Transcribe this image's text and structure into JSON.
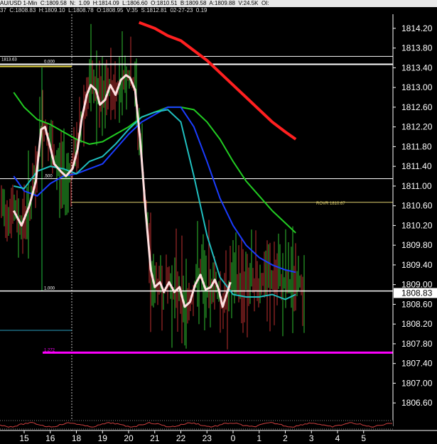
{
  "header": {
    "line1": "AU/USD 1-Min  C:1809.58  N:  1.09  H:1814.09  L:1806.60  O:1810.51  B:1809.58  A:1809.88  V:24.5K  OI:",
    "line2": "37  C:1808.83  H:1809.10  L:1808.78  O:1808.95  V:35  S:1812.81  02-27-23  0.19"
  },
  "chart_data": {
    "type": "line",
    "ylim": [
      1806.3,
      1814.4
    ],
    "y_ticks": [
      "1814.20",
      "1813.80",
      "1813.40",
      "1813.00",
      "1812.60",
      "1812.20",
      "1811.80",
      "1811.40",
      "1811.00",
      "1810.60",
      "1810.20",
      "1809.80",
      "1809.40",
      "1809.00",
      "1808.60",
      "1808.20",
      "1807.80",
      "1807.40",
      "1807.00",
      "1806.60"
    ],
    "x_ticks": [
      "15",
      "16",
      "18",
      "19",
      "20",
      "21",
      "22",
      "23",
      "0",
      "1",
      "2",
      "3",
      "4",
      "5"
    ],
    "current_price": "1808.83",
    "levels": [
      {
        "name": "top-level",
        "value": 1813.63,
        "label": "1813.63",
        "color": "#ffffff"
      },
      {
        "name": "level-000",
        "value": 1813.47,
        "label": "0.000",
        "color": "#ffffff"
      },
      {
        "name": "level-500",
        "value": 1811.15,
        "label": ".500",
        "color": "#ffffff"
      },
      {
        "name": "rovr",
        "value": 1810.67,
        "label": "ROVR 1810.67",
        "color": "#e0d070"
      },
      {
        "name": "level-1000",
        "value": 1808.87,
        "label": "1.000",
        "color": "#ffffff"
      },
      {
        "name": "level-1272",
        "value": 1807.62,
        "label": "1.272",
        "color": "#ff00ff"
      }
    ],
    "series": [
      {
        "color": "#ff2020",
        "points": [
          [
            19.4,
            1814.32
          ],
          [
            20.0,
            1814.2
          ],
          [
            20.5,
            1814.05
          ],
          [
            21.0,
            1813.95
          ],
          [
            21.5,
            1813.75
          ],
          [
            22.0,
            1813.55
          ],
          [
            22.5,
            1813.3
          ],
          [
            23.0,
            1813.05
          ],
          [
            23.5,
            1812.8
          ],
          [
            24.0,
            1812.55
          ],
          [
            24.5,
            1812.3
          ],
          [
            25.0,
            1812.1
          ],
          [
            25.4,
            1811.95
          ]
        ]
      },
      {
        "color": "#22cc22",
        "points": [
          [
            14.6,
            1812.9
          ],
          [
            15.0,
            1812.6
          ],
          [
            15.5,
            1812.35
          ],
          [
            16.0,
            1812.25
          ],
          [
            16.5,
            1812.1
          ],
          [
            17.0,
            1811.95
          ],
          [
            17.5,
            1811.85
          ],
          [
            18.0,
            1811.9
          ],
          [
            18.5,
            1812.05
          ],
          [
            19.0,
            1812.2
          ],
          [
            19.5,
            1812.4
          ],
          [
            20.0,
            1812.5
          ],
          [
            20.5,
            1812.6
          ],
          [
            21.0,
            1812.6
          ],
          [
            21.5,
            1812.55
          ],
          [
            22.0,
            1812.3
          ],
          [
            22.5,
            1811.95
          ],
          [
            23.0,
            1811.5
          ],
          [
            23.5,
            1811.1
          ],
          [
            24.0,
            1810.8
          ],
          [
            24.5,
            1810.5
          ],
          [
            25.0,
            1810.25
          ],
          [
            25.4,
            1810.05
          ]
        ]
      },
      {
        "color": "#1a3cff",
        "points": [
          [
            14.6,
            1811.2
          ],
          [
            15.0,
            1810.9
          ],
          [
            15.5,
            1810.8
          ],
          [
            16.0,
            1811.05
          ],
          [
            16.5,
            1811.2
          ],
          [
            17.0,
            1811.25
          ],
          [
            17.5,
            1811.35
          ],
          [
            18.0,
            1811.45
          ],
          [
            18.5,
            1811.75
          ],
          [
            19.0,
            1812.05
          ],
          [
            19.5,
            1812.3
          ],
          [
            20.0,
            1812.45
          ],
          [
            20.5,
            1812.6
          ],
          [
            21.0,
            1812.6
          ],
          [
            21.5,
            1812.2
          ],
          [
            22.0,
            1811.5
          ],
          [
            22.5,
            1810.75
          ],
          [
            23.0,
            1810.2
          ],
          [
            23.5,
            1809.8
          ],
          [
            24.0,
            1809.55
          ],
          [
            24.5,
            1809.4
          ],
          [
            25.0,
            1809.3
          ],
          [
            25.4,
            1809.25
          ]
        ]
      },
      {
        "color": "#20c0c0",
        "points": [
          [
            14.6,
            1811.0
          ],
          [
            15.0,
            1810.95
          ],
          [
            15.5,
            1811.3
          ],
          [
            16.0,
            1811.4
          ],
          [
            16.5,
            1811.35
          ],
          [
            17.0,
            1811.25
          ],
          [
            17.5,
            1811.5
          ],
          [
            18.0,
            1811.6
          ],
          [
            18.5,
            1811.85
          ],
          [
            19.0,
            1812.15
          ],
          [
            19.5,
            1812.4
          ],
          [
            20.0,
            1812.5
          ],
          [
            20.5,
            1812.55
          ],
          [
            21.0,
            1812.3
          ],
          [
            21.5,
            1811.2
          ],
          [
            22.0,
            1810.0
          ],
          [
            22.5,
            1809.15
          ],
          [
            23.0,
            1808.8
          ],
          [
            23.5,
            1808.75
          ],
          [
            24.0,
            1808.75
          ],
          [
            24.5,
            1808.8
          ],
          [
            25.0,
            1808.7
          ],
          [
            25.4,
            1808.8
          ]
        ]
      },
      {
        "color": "#ffe0e0",
        "points": [
          [
            14.6,
            1810.5
          ],
          [
            14.9,
            1810.2
          ],
          [
            15.2,
            1810.6
          ],
          [
            15.45,
            1811.1
          ],
          [
            15.65,
            1812.15
          ],
          [
            15.8,
            1812.2
          ],
          [
            15.95,
            1811.9
          ],
          [
            16.15,
            1811.45
          ],
          [
            16.4,
            1811.3
          ],
          [
            16.6,
            1811.2
          ],
          [
            16.85,
            1811.35
          ],
          [
            17.05,
            1811.75
          ],
          [
            17.2,
            1812.35
          ],
          [
            17.4,
            1812.85
          ],
          [
            17.55,
            1813.05
          ],
          [
            17.75,
            1812.95
          ],
          [
            17.9,
            1812.65
          ],
          [
            18.1,
            1812.75
          ],
          [
            18.3,
            1813.05
          ],
          [
            18.5,
            1812.85
          ],
          [
            18.7,
            1813.15
          ],
          [
            18.9,
            1813.25
          ],
          [
            19.05,
            1813.2
          ],
          [
            19.25,
            1812.95
          ],
          [
            19.45,
            1811.9
          ],
          [
            19.65,
            1810.5
          ],
          [
            19.85,
            1809.3
          ],
          [
            20.0,
            1808.95
          ],
          [
            20.2,
            1809.05
          ],
          [
            20.35,
            1808.85
          ],
          [
            20.55,
            1809.05
          ],
          [
            20.75,
            1808.85
          ],
          [
            20.95,
            1808.95
          ],
          [
            21.15,
            1808.55
          ],
          [
            21.35,
            1808.65
          ],
          [
            21.55,
            1809.0
          ],
          [
            21.75,
            1809.2
          ],
          [
            21.95,
            1808.9
          ],
          [
            22.15,
            1808.95
          ],
          [
            22.3,
            1809.1
          ],
          [
            22.45,
            1808.9
          ],
          [
            22.6,
            1808.55
          ],
          [
            22.75,
            1808.8
          ],
          [
            22.9,
            1809.05
          ]
        ]
      }
    ]
  }
}
